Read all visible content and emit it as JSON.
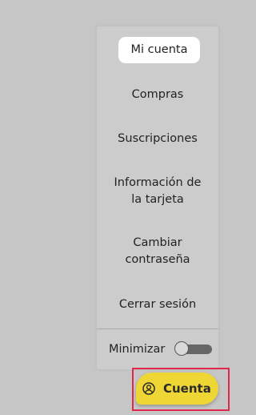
{
  "menu": {
    "items": [
      {
        "label": "Mi cuenta",
        "active": true
      },
      {
        "label": "Compras"
      },
      {
        "label": "Suscripciones"
      },
      {
        "label": "Información de la tarjeta"
      },
      {
        "label": "Cambiar contraseña"
      },
      {
        "label": "Cerrar sesión"
      }
    ],
    "minimize_label": "Minimizar",
    "minimize_enabled": false
  },
  "account_button": {
    "label": "Cuenta",
    "icon": "user-circle-icon",
    "color": "#eed634"
  },
  "colors": {
    "panel": "#cccccc",
    "highlight_frame": "#e0284c",
    "text": "#222222"
  }
}
